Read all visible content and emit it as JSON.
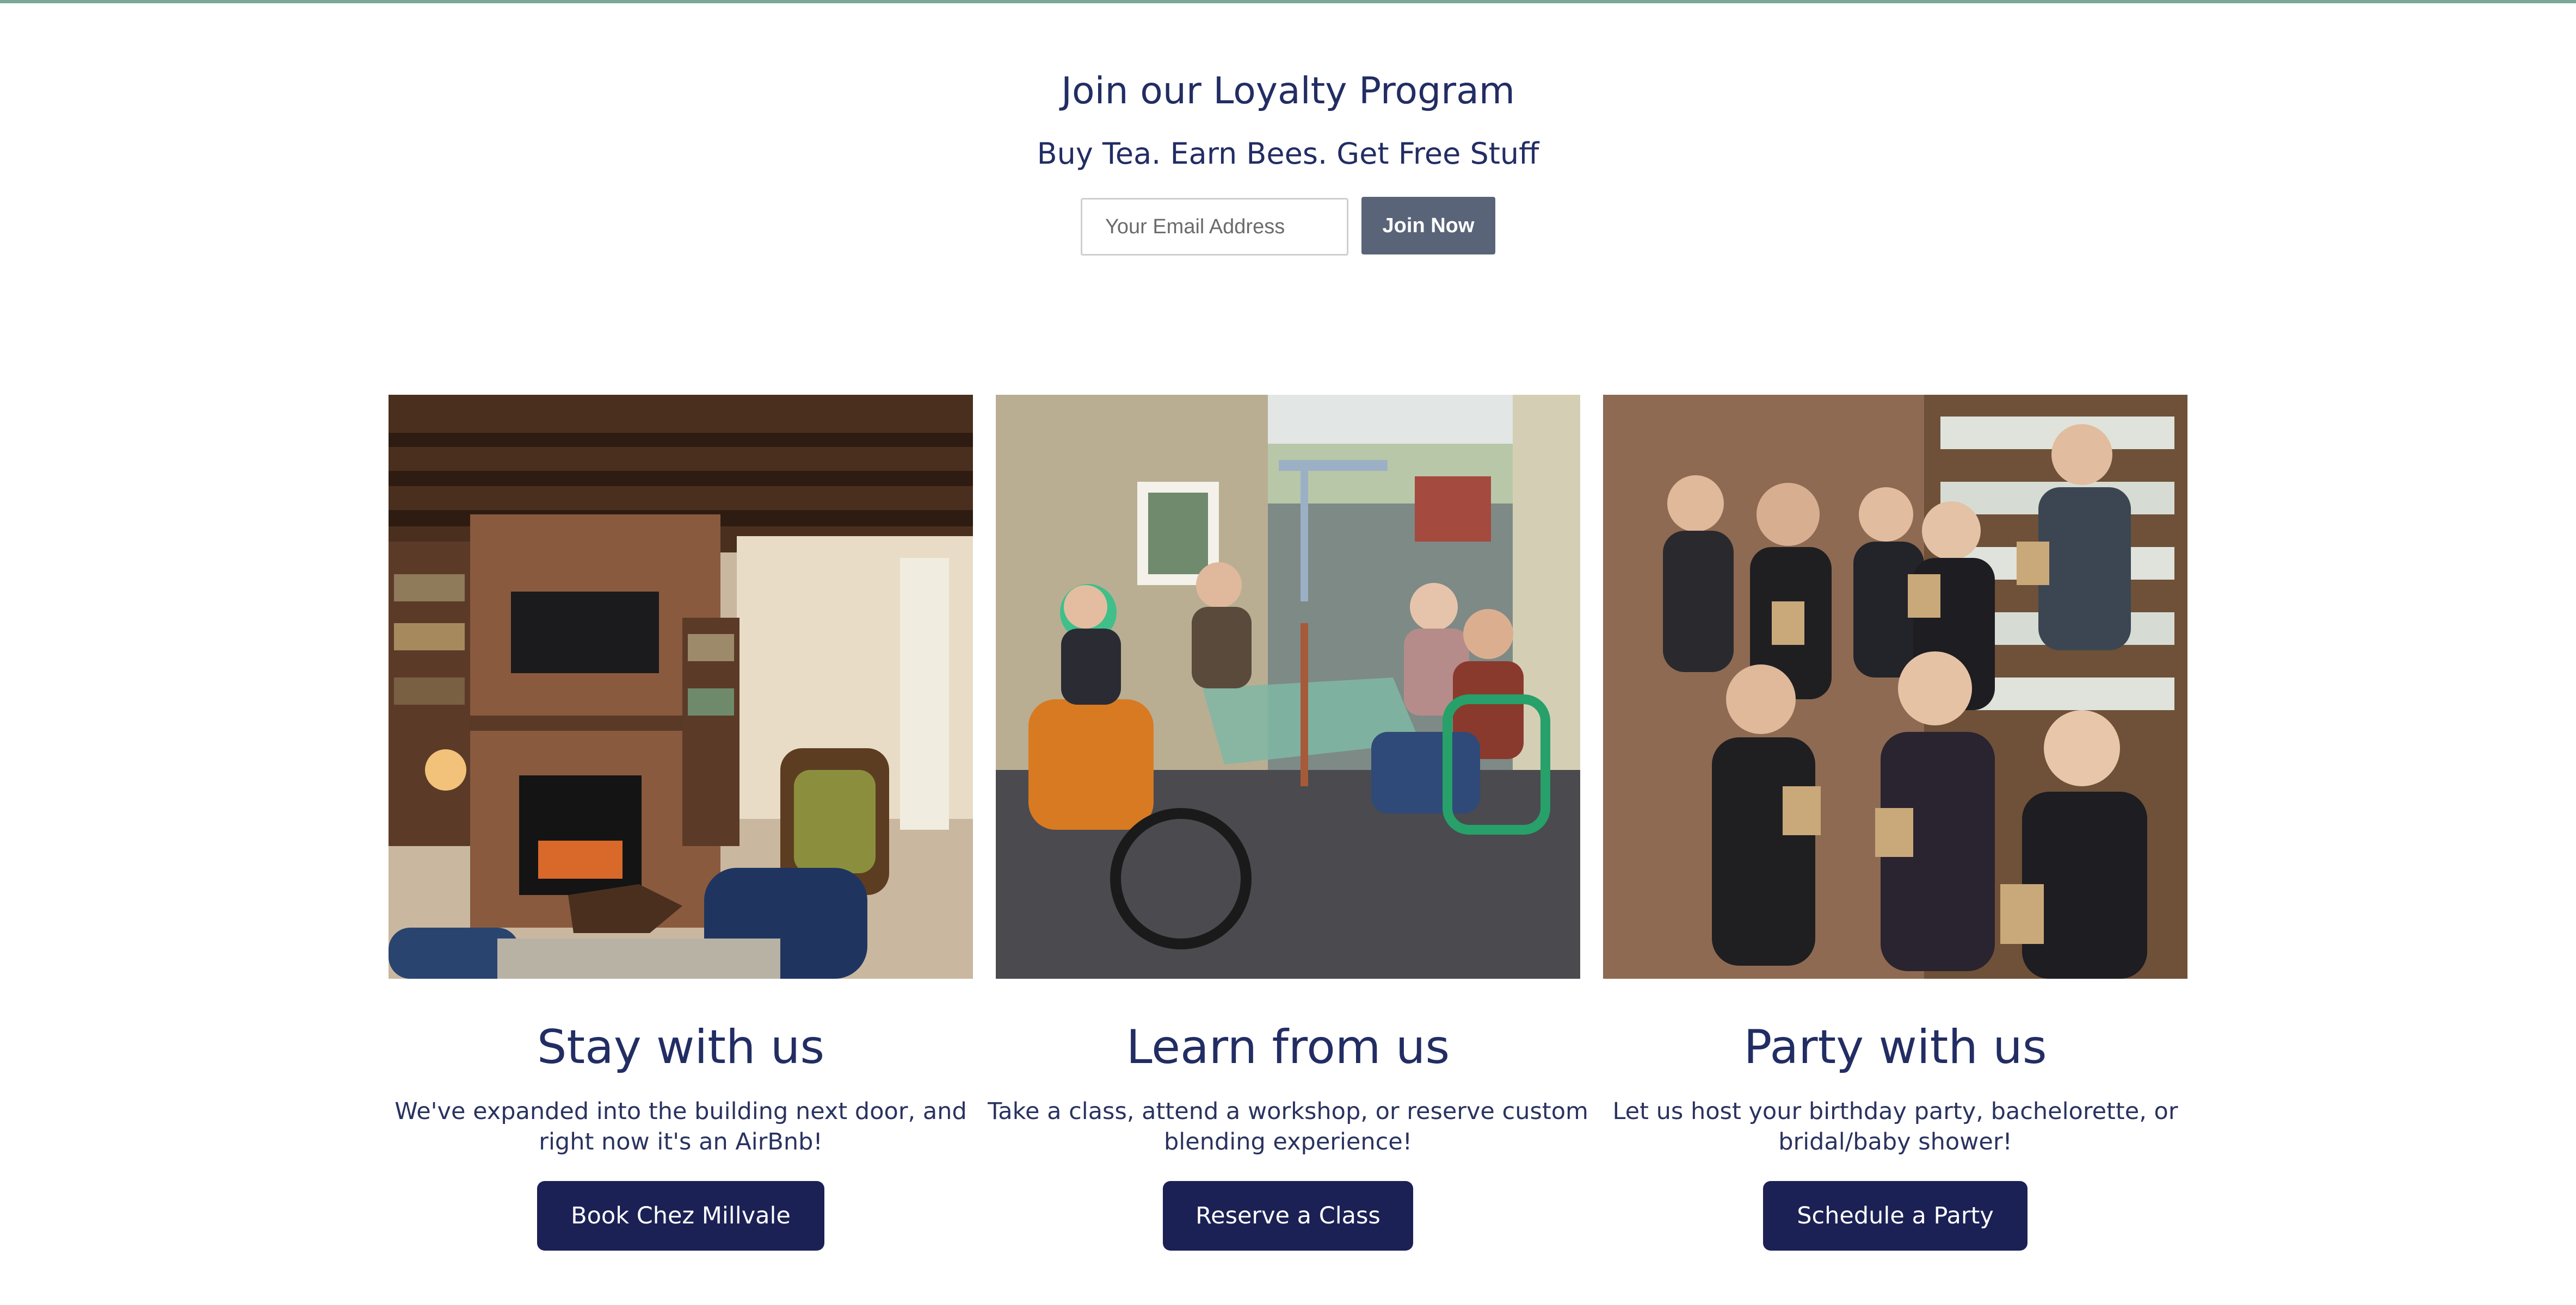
{
  "loyalty": {
    "title": "Join our Loyalty Program",
    "subtitle": "Buy Tea. Earn Bees. Get Free Stuff",
    "email_placeholder": "Your Email Address",
    "join_label": "Join Now"
  },
  "colors": {
    "accent_line": "#7aa79a",
    "heading": "#222d63",
    "button_dark": "#1b2155",
    "button_gray": "#5a6478"
  },
  "cards": [
    {
      "title": "Stay with us",
      "text": "We've expanded into the building next door, and right now it's an AirBnb!",
      "button_label": "Book Chez Millvale",
      "photo": "living-room-fireplace-photo"
    },
    {
      "title": "Learn from us",
      "text": "Take a class, attend a workshop, or reserve custom blending experience!",
      "button_label": "Reserve a Class",
      "photo": "outdoor-patio-group-photo"
    },
    {
      "title": "Party with us",
      "text": "Let us host your birthday party, bachelorette, or bridal/baby shower!",
      "button_label": "Schedule a Party",
      "photo": "tea-shop-party-photo"
    }
  ]
}
